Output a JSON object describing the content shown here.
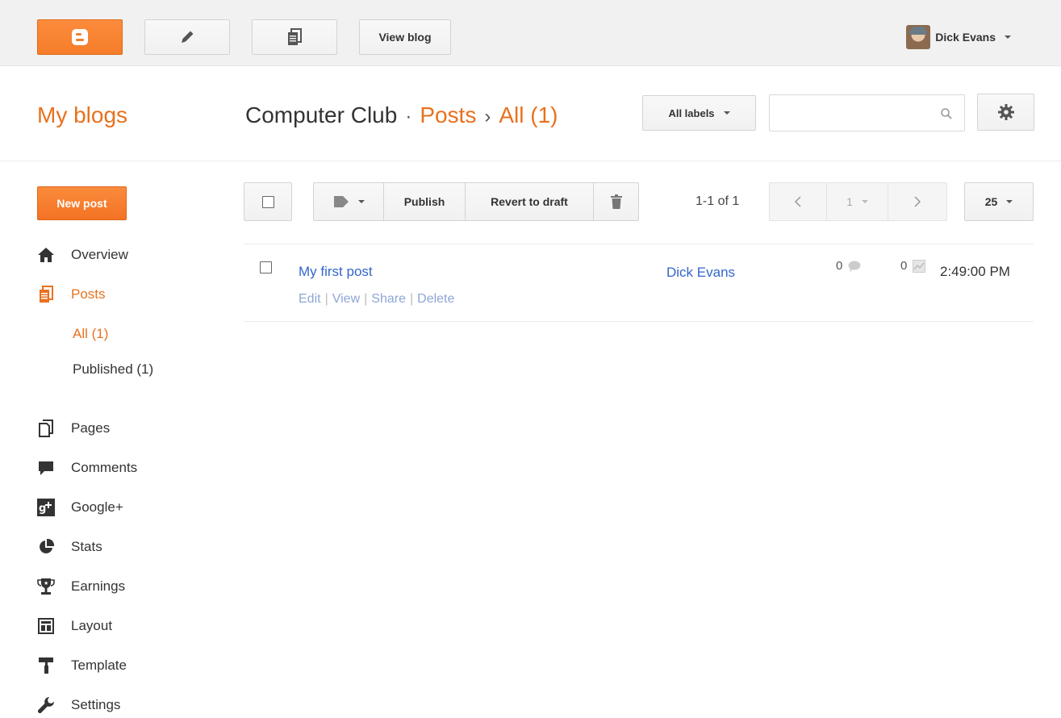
{
  "topbar": {
    "view_blog_label": "View blog",
    "user_name": "Dick Evans"
  },
  "header": {
    "my_blogs": "My blogs",
    "blog_name": "Computer Club",
    "crumb_separator": "·",
    "section": "Posts",
    "arrow": "›",
    "filter": "All (1)",
    "labels_button": "All labels",
    "search": {
      "value": "",
      "placeholder": ""
    }
  },
  "sidebar": {
    "new_post_label": "New post",
    "items": [
      {
        "label": "Overview",
        "icon": "home-icon"
      },
      {
        "label": "Posts",
        "icon": "posts-icon",
        "active": true
      },
      {
        "label": "Pages",
        "icon": "pages-icon"
      },
      {
        "label": "Comments",
        "icon": "comment-icon"
      },
      {
        "label": "Google+",
        "icon": "google-plus-icon"
      },
      {
        "label": "Stats",
        "icon": "pie-chart-icon"
      },
      {
        "label": "Earnings",
        "icon": "trophy-icon"
      },
      {
        "label": "Layout",
        "icon": "layout-icon"
      },
      {
        "label": "Template",
        "icon": "paint-roller-icon"
      },
      {
        "label": "Settings",
        "icon": "wrench-icon"
      }
    ],
    "subitems": [
      {
        "label": "All (1)",
        "active": true
      },
      {
        "label": "Published (1)"
      }
    ]
  },
  "toolbar": {
    "publish_label": "Publish",
    "revert_label": "Revert to draft",
    "count": "1-1 of 1",
    "page": "1",
    "per_page": "25"
  },
  "posts": [
    {
      "title": "My first post",
      "actions": [
        "Edit",
        "View",
        "Share",
        "Delete"
      ],
      "author": "Dick Evans",
      "comments": "0",
      "views": "0",
      "time": "2:49:00 PM"
    }
  ],
  "colors": {
    "accent": "#e8711d",
    "link": "#3366cc"
  }
}
